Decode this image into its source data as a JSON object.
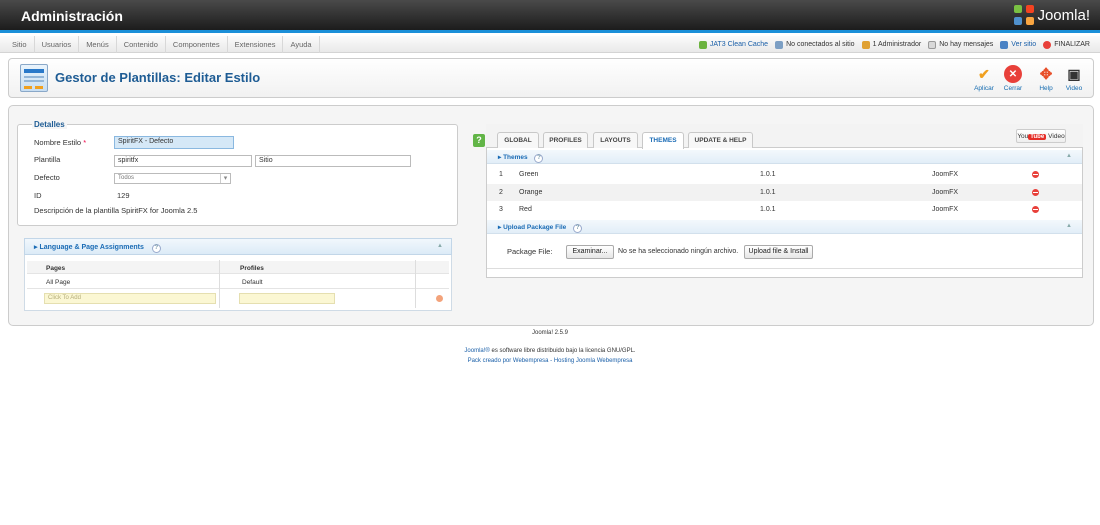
{
  "header": {
    "title": "Administración",
    "logo_text": "Joomla!"
  },
  "menu": {
    "items": [
      "Sitio",
      "Usuarios",
      "Menús",
      "Contenido",
      "Componentes",
      "Extensiones",
      "Ayuda"
    ]
  },
  "status": {
    "cache": "JAT3 Clean Cache",
    "visitors": "No conectados al sitio",
    "admins": "1 Administrador",
    "messages": "No hay mensajes",
    "view_site": "Ver sitio",
    "logout": "FINALIZAR"
  },
  "toolbar": {
    "title": "Gestor de Plantillas: Editar Estilo",
    "apply": "Aplicar",
    "close": "Cerrar",
    "help": "Help",
    "video": "Video"
  },
  "details": {
    "legend": "Detalles",
    "style_name_label": "Nombre Estilo",
    "required_mark": "*",
    "style_name_value": "SpiritFX - Defecto",
    "template_label": "Plantilla",
    "template_value": "spiritfx",
    "client_value": "Sitio",
    "default_label": "Defecto",
    "default_value": "Todos",
    "id_label": "ID",
    "id_value": "129",
    "desc_label": "Descripción de la plantilla",
    "desc_value": "SpiritFX for Joomla 2.5"
  },
  "assignments": {
    "title": "Language & Page Assignments",
    "help": "?",
    "col_pages": "Pages",
    "col_profiles": "Profiles",
    "row_page": "All Page",
    "row_profile": "Default",
    "click_to_add": "Click To Add"
  },
  "tabs": [
    "GLOBAL",
    "PROFILES",
    "LAYOUTS",
    "THEMES",
    "UPDATE & HELP"
  ],
  "active_tab": "THEMES",
  "help_button": "?",
  "youtube": {
    "logo_you": "You",
    "logo_tube": "Tube",
    "label": "Video"
  },
  "themes": {
    "title": "Themes",
    "help": "?",
    "rows": [
      {
        "num": "1",
        "name": "Green",
        "version": "1.0.1",
        "author": "JoomFX"
      },
      {
        "num": "2",
        "name": "Orange",
        "version": "1.0.1",
        "author": "JoomFX"
      },
      {
        "num": "3",
        "name": "Red",
        "version": "1.0.1",
        "author": "JoomFX"
      }
    ]
  },
  "upload": {
    "title": "Upload Package File",
    "help": "?",
    "label": "Package File:",
    "browse": "Examinar...",
    "no_file": "No se ha seleccionado ningún archivo.",
    "submit": "Upload file & Install"
  },
  "footer": {
    "version": "Joomla! 2.5.9",
    "license_link": "Joomla!®",
    "license_text": " es software libre distribuido bajo la licencia GNU/GPL.",
    "credit": "Pack creado por Webempresa - Hosting Joomla Webempresa"
  },
  "colors": {
    "accent": "#1b8fd8",
    "title": "#1e5c94",
    "link": "#1a6bb5",
    "danger": "#e8403a",
    "help_green": "#62b547"
  }
}
